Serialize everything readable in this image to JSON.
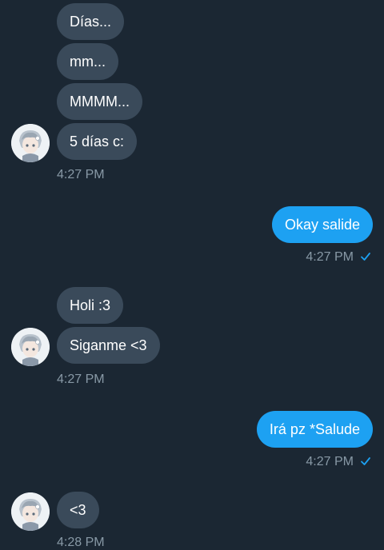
{
  "colors": {
    "background": "#1b2733",
    "incoming_bubble": "#3a4a5a",
    "outgoing_bubble": "#1da1f2",
    "timestamp": "#8899a6",
    "check": "#1da1f2"
  },
  "messages": {
    "group1": {
      "bubbles": [
        "Días...",
        "mm...",
        "MMMM...",
        "5 días c:"
      ],
      "time": "4:27 PM"
    },
    "out1": {
      "text": "Okay salide",
      "time": "4:27 PM",
      "status_icon": "check-icon"
    },
    "group2": {
      "bubbles": [
        "Holi :3",
        "Siganme <3"
      ],
      "time": "4:27 PM"
    },
    "out2": {
      "text": "Irá pz *Salude",
      "time": "4:27 PM",
      "status_icon": "check-icon"
    },
    "group3": {
      "bubbles": [
        "<3"
      ],
      "time": "4:28 PM"
    }
  }
}
